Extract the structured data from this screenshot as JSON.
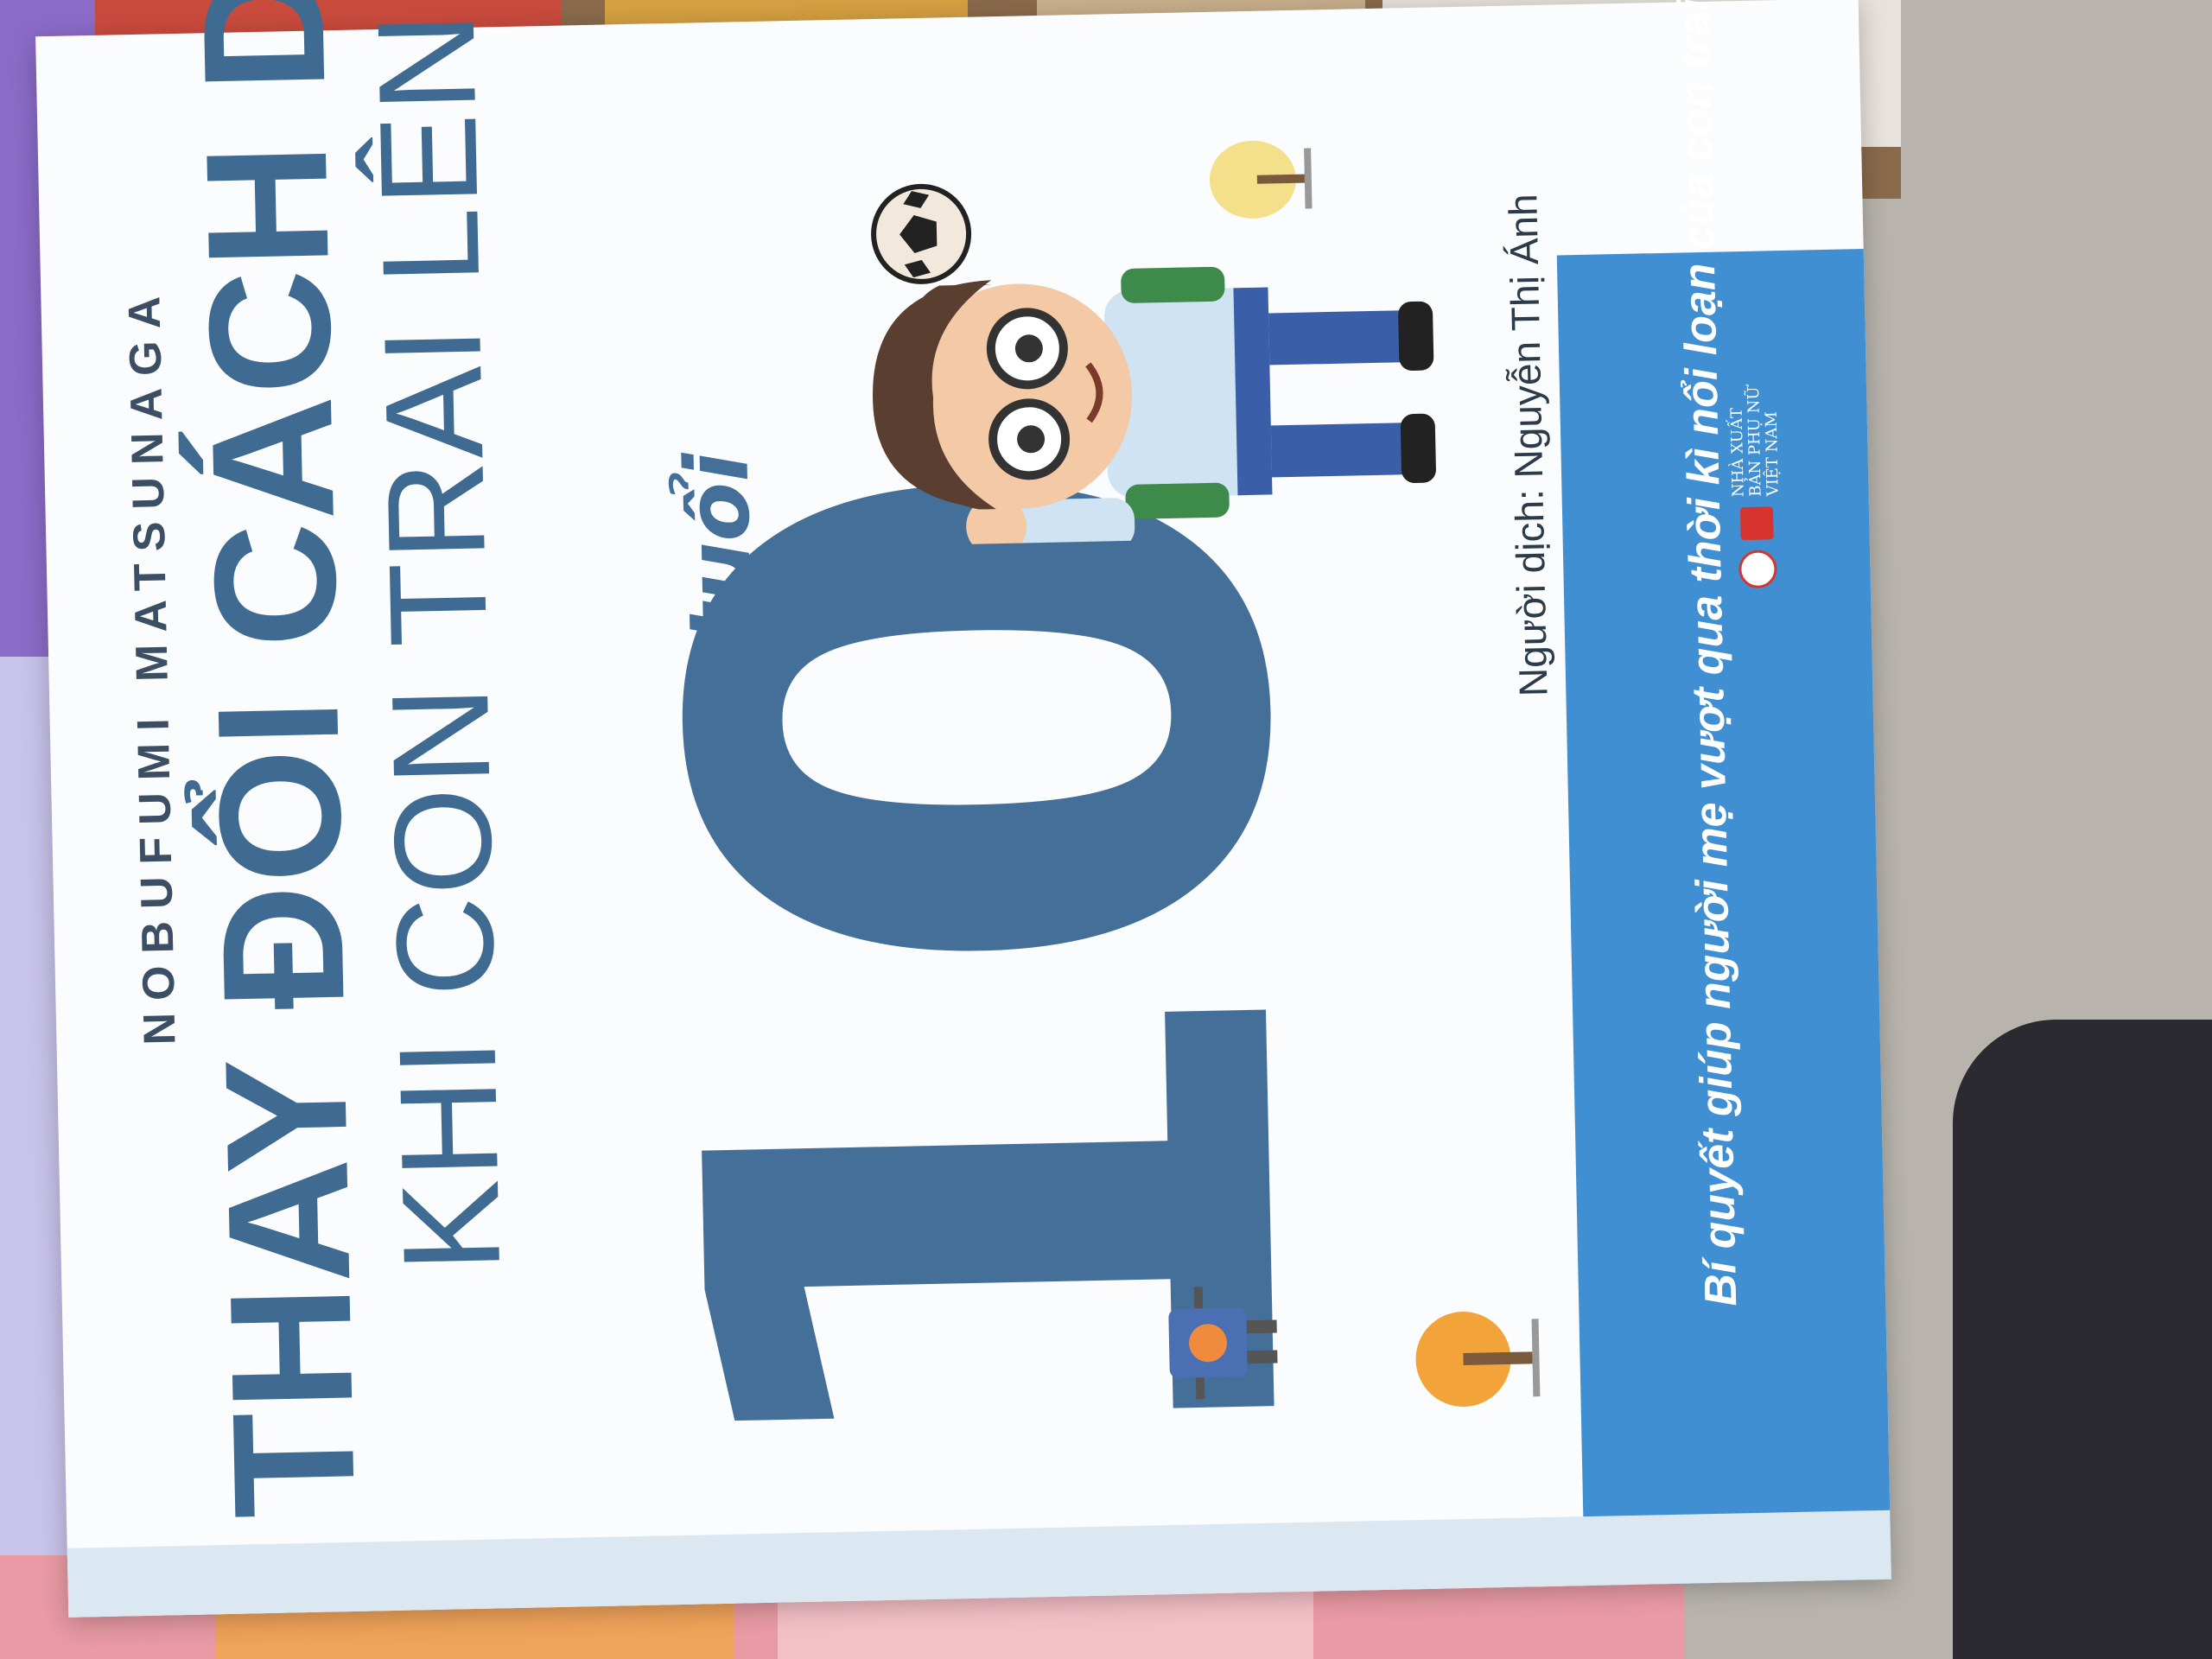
{
  "book": {
    "author": "NOBUFUMI MATSUNAGA",
    "title_line1": "THAY ĐỔI CÁCH DẠY",
    "title_line2": "KHI CON TRAI LÊN",
    "age_number": "10",
    "age_word": "tuổi",
    "translator": "Người dịch: Nguyễn Thị Ánh",
    "tagline": "Bí quyết giúp người mẹ vượt qua thời kì nổi loạn của con trai",
    "publisher": "NHÀ XUẤT BẢN PHỤ NỮ VIỆT NAM"
  },
  "colors": {
    "cover_white": "#fbfcfd",
    "title_blue": "#3f6b92",
    "number_blue": "#446f98",
    "band_blue": "#3f8fd2",
    "publisher_red": "#d8342f"
  },
  "illustrations": [
    "boy-with-glasses",
    "soccer-ball",
    "tree",
    "robot",
    "orange-tree"
  ]
}
